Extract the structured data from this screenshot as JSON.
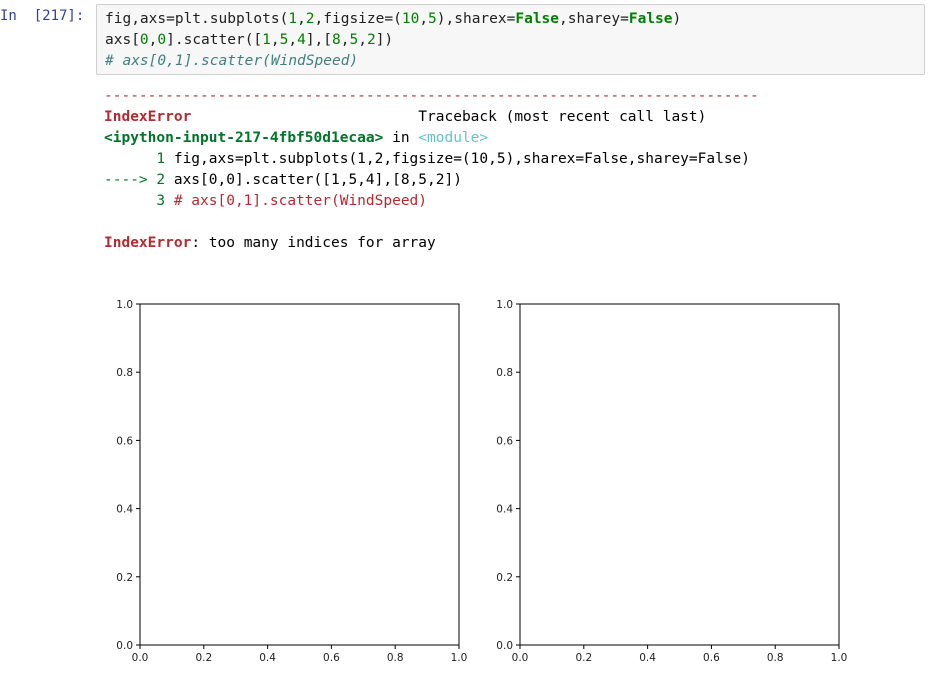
{
  "cell": {
    "prompt": "In  [217]:",
    "code": {
      "line1": {
        "p1": "fig,axs=plt.subplots(",
        "n1": "1",
        "c1": ",",
        "n2": "2",
        "c2": ",figsize=(",
        "n3": "10",
        "c3": ",",
        "n4": "5",
        "c4": "),sharex=",
        "k1": "False",
        "c5": ",sharey=",
        "k2": "False",
        "c6": ")"
      },
      "line2": {
        "p1": "axs[",
        "n1": "0",
        "c1": ",",
        "n2": "0",
        "c2": "].scatter([",
        "n3": "1",
        "c3": ",",
        "n4": "5",
        "c4": ",",
        "n5": "4",
        "c5": "],[",
        "n6": "8",
        "c6": ",",
        "n7": "5",
        "c7": ",",
        "n8": "2",
        "c8": "])"
      },
      "line3": "# axs[0,1].scatter(WindSpeed)"
    }
  },
  "error": {
    "dash": "---------------------------------------------------------------------------",
    "name": "IndexError",
    "traceback_label": "Traceback (most recent call last)",
    "location": "<ipython-input-217-4fbf50d1ecaa>",
    "in_word": " in ",
    "module": "<module>",
    "tb1_num": "      1 ",
    "tb1_code": "fig,axs=plt.subplots(1,2,figsize=(10,5),sharex=False,sharey=False)",
    "tb2_arrow": "----> 2 ",
    "tb2_code": "axs[0,0].scatter([1,5,4],[8,5,2])",
    "tb3_num": "      3 ",
    "tb3_code": "# axs[0,1].scatter(WindSpeed)",
    "final_name": "IndexError",
    "final_msg": ": too many indices for array"
  },
  "chart_data": [
    {
      "type": "scatter",
      "x": [],
      "y": [],
      "xlim": [
        0,
        1
      ],
      "ylim": [
        0,
        1
      ],
      "xticks": [
        "0.0",
        "0.2",
        "0.4",
        "0.6",
        "0.8",
        "1.0"
      ],
      "yticks": [
        "0.0",
        "0.2",
        "0.4",
        "0.6",
        "0.8",
        "1.0"
      ],
      "title": "",
      "xlabel": "",
      "ylabel": "",
      "grid": false
    },
    {
      "type": "scatter",
      "x": [],
      "y": [],
      "xlim": [
        0,
        1
      ],
      "ylim": [
        0,
        1
      ],
      "xticks": [
        "0.0",
        "0.2",
        "0.4",
        "0.6",
        "0.8",
        "1.0"
      ],
      "yticks": [
        "0.0",
        "0.2",
        "0.4",
        "0.6",
        "0.8",
        "1.0"
      ],
      "title": "",
      "xlabel": "",
      "ylabel": "",
      "grid": false
    }
  ]
}
